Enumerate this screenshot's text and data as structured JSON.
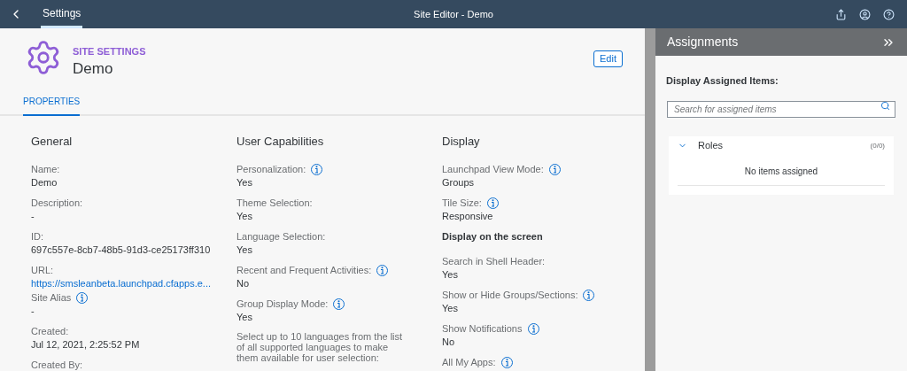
{
  "shell": {
    "tab": {
      "label": "Settings",
      "selected": true
    },
    "title": "Site Editor - Demo"
  },
  "page": {
    "eyebrow": "SITE SETTINGS",
    "title": "Demo",
    "edit_button": "Edit",
    "tabs": [
      {
        "label": "PROPERTIES",
        "selected": true
      }
    ]
  },
  "columns": [
    {
      "title": "General",
      "items": [
        {
          "kind": "field",
          "label": "Name:",
          "value": "Demo",
          "info": false
        },
        {
          "kind": "field",
          "label": "Description:",
          "value": "-",
          "info": false
        },
        {
          "kind": "field",
          "label": "ID:",
          "value": "697c557e-8cb7-48b5-91d3-ce25173ff310",
          "info": false
        },
        {
          "kind": "link",
          "label": "URL:",
          "value": "https://smsleanbeta.launchpad.cfapps.e...",
          "info": false
        },
        {
          "kind": "field",
          "label": "Site Alias",
          "value": "-",
          "info": true
        },
        {
          "kind": "field",
          "label": "Created:",
          "value": "Jul 12, 2021, 2:25:52 PM",
          "info": false
        },
        {
          "kind": "field",
          "label": "Created By:",
          "info": false
        }
      ]
    },
    {
      "title": "User Capabilities",
      "items": [
        {
          "kind": "field",
          "label": "Personalization:",
          "value": "Yes",
          "info": true
        },
        {
          "kind": "field",
          "label": "Theme Selection:",
          "value": "Yes",
          "info": false
        },
        {
          "kind": "field",
          "label": "Language Selection:",
          "value": "Yes",
          "info": false
        },
        {
          "kind": "field",
          "label": "Recent and Frequent Activities:",
          "value": "No",
          "info": true
        },
        {
          "kind": "field",
          "label": "Group Display Mode:",
          "value": "Yes",
          "info": true
        },
        {
          "kind": "note",
          "label": "Select up to 10 languages from the list of all supported languages to make them available for user selection:"
        }
      ]
    },
    {
      "title": "Display",
      "items": [
        {
          "kind": "field",
          "label": "Launchpad View Mode:",
          "value": "Groups",
          "info": true
        },
        {
          "kind": "field",
          "label": "Tile Size:",
          "value": "Responsive",
          "info": true
        },
        {
          "kind": "subheading",
          "label": "Display on the screen"
        },
        {
          "kind": "field",
          "label": "Search in Shell Header:",
          "value": "Yes",
          "info": false
        },
        {
          "kind": "field",
          "label": "Show or Hide Groups/Sections:",
          "value": "Yes",
          "info": true
        },
        {
          "kind": "field",
          "label": "Show Notifications",
          "value": "No",
          "info": true
        },
        {
          "kind": "field",
          "label": "All My Apps:",
          "info": true
        }
      ]
    }
  ],
  "assignments": {
    "title": "Assignments",
    "label": "Display Assigned Items:",
    "search": {
      "placeholder": "Search for assigned items"
    },
    "groups": [
      {
        "name": "Roles",
        "count": "(0/0)",
        "expanded": true,
        "empty_text": "No items assigned"
      }
    ]
  }
}
